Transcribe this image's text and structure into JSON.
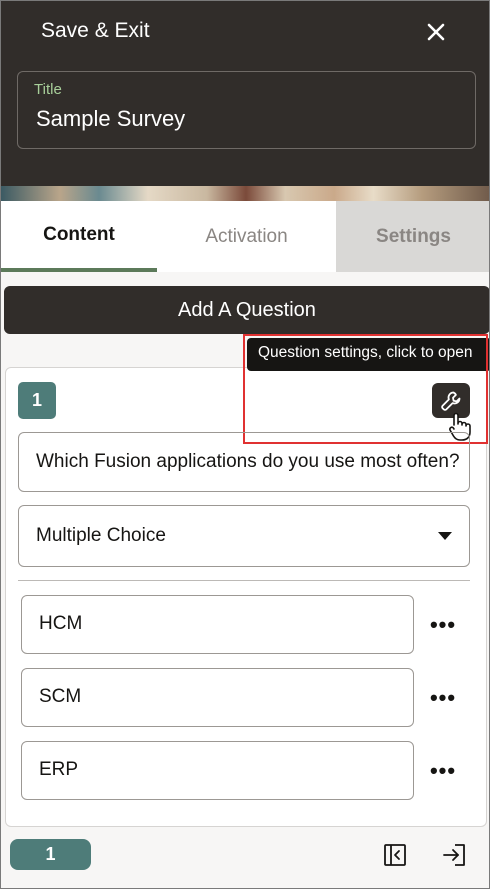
{
  "header": {
    "save_exit_label": "Save & Exit",
    "close_icon": "close-icon",
    "title_label": "Title",
    "title_value": "Sample Survey"
  },
  "tabs": [
    {
      "label": "Content",
      "active": true
    },
    {
      "label": "Activation",
      "active": false
    },
    {
      "label": "Settings",
      "active": false,
      "disabled": true
    }
  ],
  "add_question_label": "Add A Question",
  "question": {
    "number": "1",
    "settings_icon": "wrench-icon",
    "tooltip": "Question settings, click to open",
    "text": "Which Fusion applications do you use most often?",
    "type": "Multiple Choice",
    "options": [
      {
        "label": "HCM"
      },
      {
        "label": "SCM"
      },
      {
        "label": "ERP"
      }
    ],
    "option_menu_glyph": "•••"
  },
  "footer": {
    "page_number": "1",
    "collapse_icon": "panel-collapse-icon",
    "exit_icon": "sign-in-icon"
  },
  "colors": {
    "header_bg": "#312d2a",
    "accent_teal": "#4e7c79",
    "tab_underline": "#5c7a5a",
    "title_label": "#a8cf9a",
    "highlight": "#e03131"
  }
}
